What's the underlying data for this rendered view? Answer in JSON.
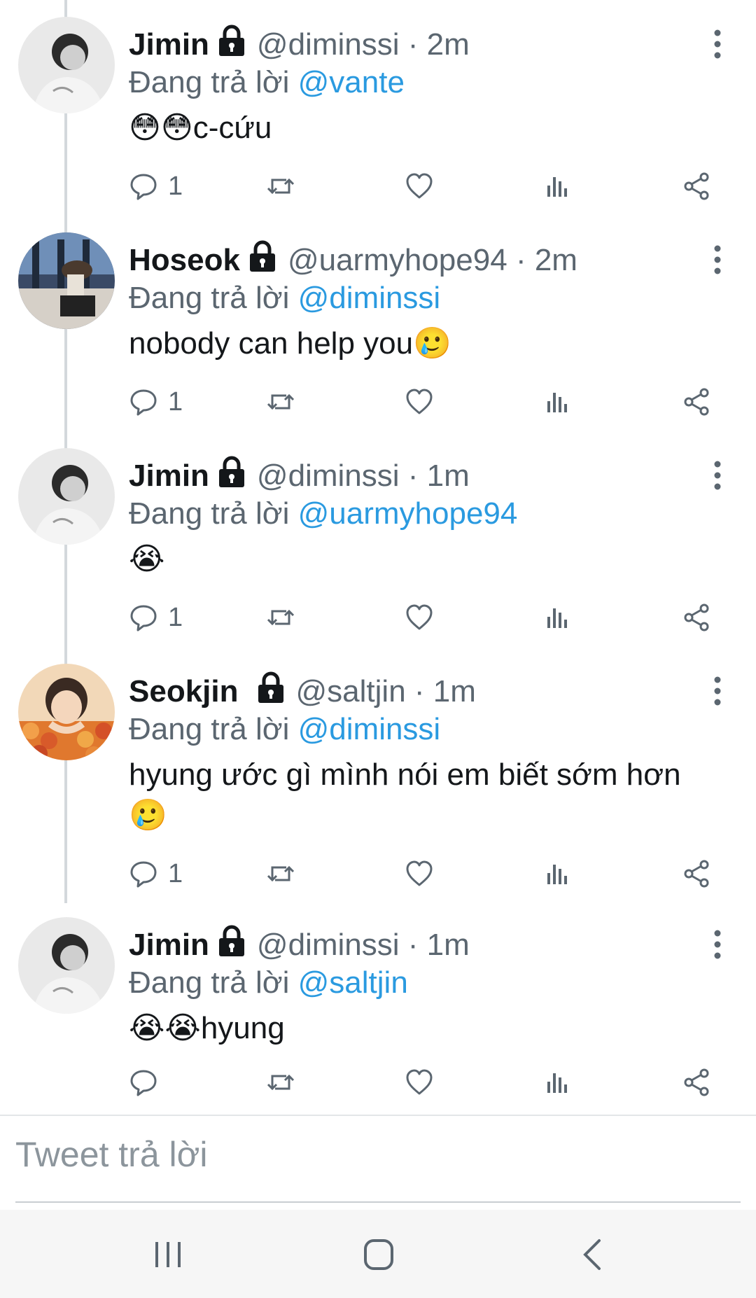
{
  "tweets": [
    {
      "name": "Jimin",
      "handle": "@diminssi",
      "time": "· 2m",
      "reply_prefix": "Đang trả lời",
      "reply_to": "@vante",
      "emoji": "😳😳",
      "text": "c-cứu",
      "reply_count": "1"
    },
    {
      "name": "Hoseok",
      "handle": "@uarmyhope94",
      "time": "· 2m",
      "reply_prefix": "Đang trả lời",
      "reply_to": "@diminssi",
      "text": "nobody can help you",
      "emoji": "🥲",
      "reply_count": "1"
    },
    {
      "name": "Jimin",
      "handle": "@diminssi",
      "time": "· 1m",
      "reply_prefix": "Đang trả lời",
      "reply_to": "@uarmyhope94",
      "emoji": "😭",
      "text": "",
      "reply_count": "1"
    },
    {
      "name": "Seokjin",
      "handle": "@saltjin",
      "time": "· 1m",
      "reply_prefix": "Đang trả lời",
      "reply_to": "@diminssi",
      "text": "hyung ước gì mình nói em biết sớm hơn",
      "emoji": "🥲",
      "reply_count": "1"
    },
    {
      "name": "Jimin",
      "handle": "@diminssi",
      "time": "· 1m",
      "reply_prefix": "Đang trả lời",
      "reply_to": "@saltjin",
      "emoji": "😭😭",
      "text": "hyung",
      "reply_count": ""
    }
  ],
  "compose": {
    "placeholder": "Tweet trả lời"
  },
  "icons": {
    "lock": "lock-icon",
    "reply": "reply-icon",
    "retweet": "retweet-icon",
    "like": "heart-icon",
    "analytics": "analytics-icon",
    "share": "share-icon",
    "more": "more-vertical-icon",
    "nav_recents": "recent-apps-icon",
    "nav_home": "home-icon",
    "nav_back": "back-icon"
  },
  "colors": {
    "mention": "#2a9ae0",
    "secondary_text": "#5b6670",
    "primary_text": "#14171a"
  }
}
